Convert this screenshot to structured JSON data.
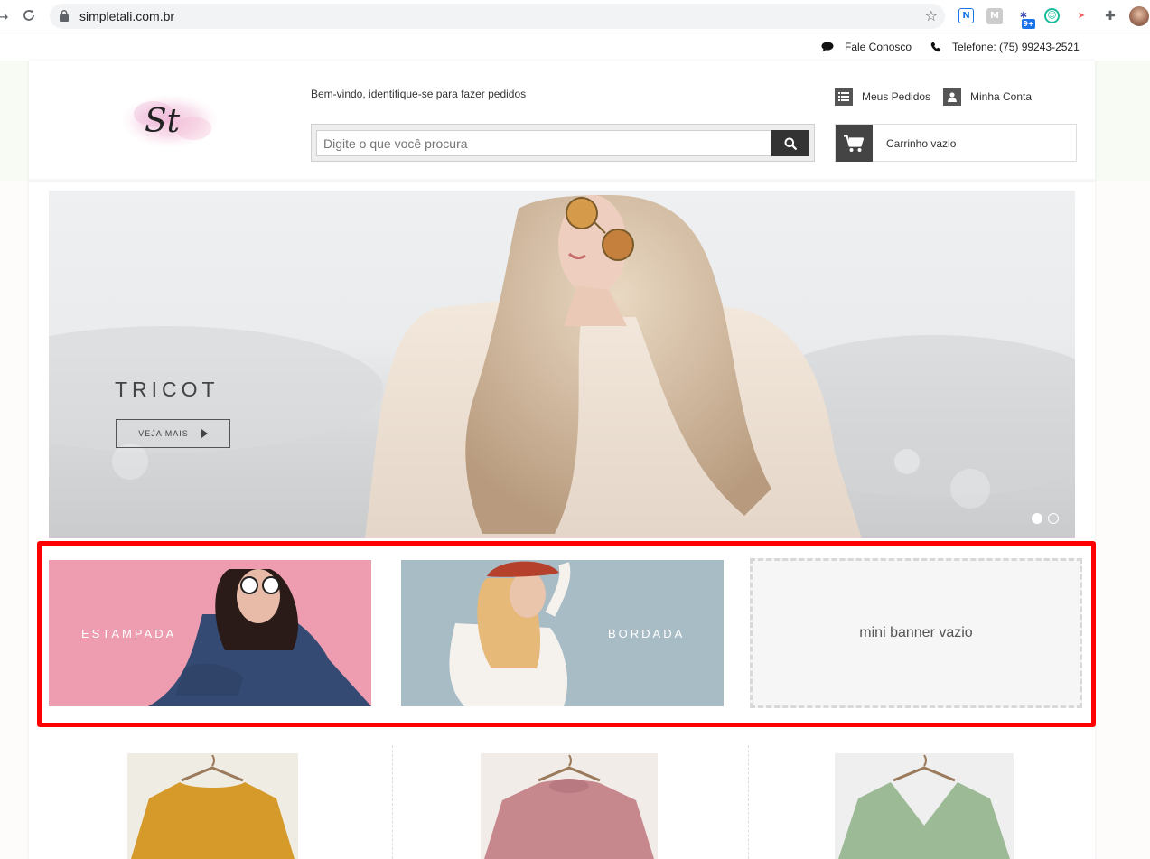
{
  "browser": {
    "url": "simpletali.com.br",
    "extension_badge": "9+"
  },
  "util_bar": {
    "contact_label": "Fale Conosco",
    "phone_label": "Telefone: (75) 99243-2521"
  },
  "header": {
    "logo_text": "St",
    "welcome_text": "Bem-vindo, identifique-se para fazer pedidos",
    "search_placeholder": "Digite o que você procura",
    "my_orders_label": "Meus Pedidos",
    "my_account_label": "Minha Conta",
    "cart_label": "Carrinho vazio"
  },
  "hero": {
    "title": "TRICOT",
    "button_label": "VEJA MAIS",
    "slides_total": 2,
    "active_slide": 1
  },
  "mini_banners": [
    {
      "label": "ESTAMPADA",
      "color": "#ee9db1"
    },
    {
      "label": "BORDADA",
      "color": "#a8bcc6"
    },
    {
      "empty_label": "mini banner vazio"
    }
  ],
  "products": [
    {
      "color": "#d69a2a"
    },
    {
      "color": "#c7888d"
    },
    {
      "color": "#9cba95"
    }
  ]
}
